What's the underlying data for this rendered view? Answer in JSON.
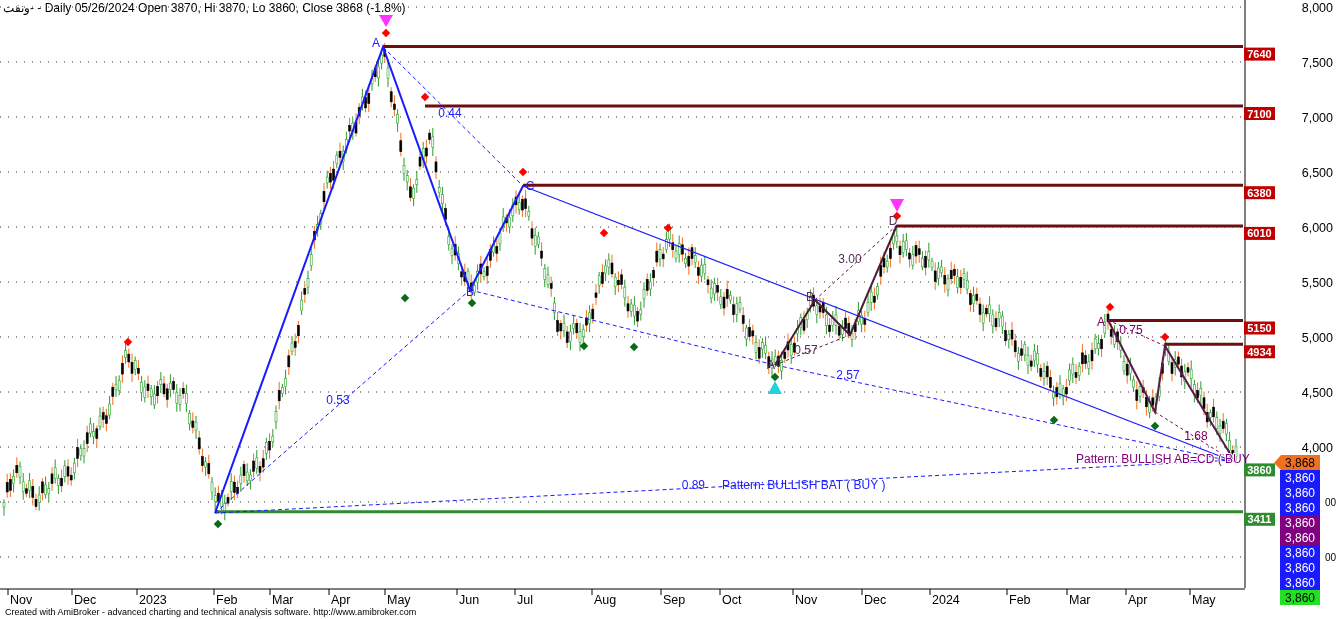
{
  "title": "ونفت- - Daily 05/26/2024 Open 3870, Hi 3870, Lo 3860, Close 3868 (-1.8%)",
  "y_axis": {
    "ticks": [
      "8,000",
      "7,500",
      "7,000",
      "6,500",
      "6,000",
      "5,500",
      "5,000",
      "4,500",
      "4,000"
    ],
    "covered_ticks": [
      "00",
      "00"
    ]
  },
  "x_axis": {
    "labels": [
      "Nov",
      "Dec",
      "2023",
      "Feb",
      "Mar",
      "Apr",
      "May",
      "Jun",
      "Jul",
      "Aug",
      "Sep",
      "Oct",
      "Nov",
      "Dec",
      "2024",
      "Feb",
      "Mar",
      "Apr",
      "May"
    ]
  },
  "levels": [
    {
      "label": "7640",
      "color": "#c00000",
      "kind": "line"
    },
    {
      "label": "7100",
      "color": "#c00000",
      "kind": "line"
    },
    {
      "label": "6380",
      "color": "#c00000",
      "kind": "line"
    },
    {
      "label": "6010",
      "color": "#c00000",
      "kind": "line"
    },
    {
      "label": "5150",
      "color": "#c00000",
      "kind": "line"
    },
    {
      "label": "4934",
      "color": "#c00000",
      "kind": "line"
    },
    {
      "label": "3860",
      "color": "#2e8b2e",
      "kind": "tag"
    },
    {
      "label": "3411",
      "color": "#2e8b2e",
      "kind": "line"
    }
  ],
  "price_tags": [
    {
      "label": "3,868",
      "color": "#f07020"
    },
    {
      "label": "3,860",
      "color": "#1a1aff"
    },
    {
      "label": "3,860",
      "color": "#1a1aff"
    },
    {
      "label": "3,860",
      "color": "#1a1aff"
    },
    {
      "label": "3,860",
      "color": "#800080"
    },
    {
      "label": "3,860",
      "color": "#800080"
    },
    {
      "label": "3,860",
      "color": "#1a1aff"
    },
    {
      "label": "3,860",
      "color": "#1a1aff"
    },
    {
      "label": "3,860",
      "color": "#1a1aff"
    },
    {
      "label": "3,860",
      "color": "#22e022"
    }
  ],
  "pattern_labels": [
    {
      "text": "A",
      "color": "#2020ff"
    },
    {
      "text": "B",
      "color": "#2020ff"
    },
    {
      "text": "C",
      "color": "#2020ff"
    },
    {
      "text": "0.44",
      "color": "#2020ff"
    },
    {
      "text": "0.53",
      "color": "#2020ff"
    },
    {
      "text": "0.89",
      "color": "#2020ff"
    },
    {
      "text": "Pattern: BULLISH BAT ( BUY )",
      "color": "#2020ff"
    },
    {
      "text": "A",
      "color": "#5a2a5a"
    },
    {
      "text": "B",
      "color": "#5a2a5a"
    },
    {
      "text": "D",
      "color": "#5a2a5a"
    },
    {
      "text": "0.57",
      "color": "#5a2a5a"
    },
    {
      "text": "3.00",
      "color": "#5a2a5a"
    },
    {
      "text": "2.57",
      "color": "#2020ff"
    },
    {
      "text": "A",
      "color": "#800060"
    },
    {
      "text": "0.75",
      "color": "#800060"
    },
    {
      "text": "1.68",
      "color": "#800060"
    },
    {
      "text": "Pattern: BULLISH AB=CD ( BUY",
      "color": "#800080"
    }
  ],
  "footer": "Created with AmiBroker - advanced charting and technical analysis software. http://www.amibroker.com"
}
